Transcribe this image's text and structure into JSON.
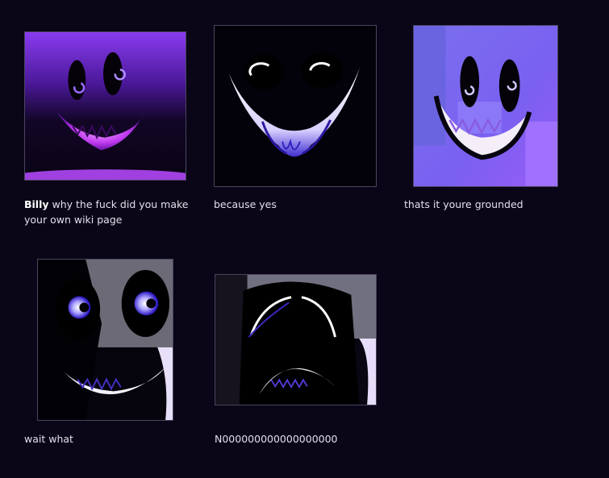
{
  "gallery": {
    "items": [
      {
        "caption_bold": "Billy",
        "caption_text": " why the fuck did you make your own wiki page"
      },
      {
        "caption_text": "because yes"
      },
      {
        "caption_text": "thats it youre grounded"
      },
      {
        "caption_text": "wait what"
      },
      {
        "caption_text": "N000000000000000000"
      }
    ]
  }
}
